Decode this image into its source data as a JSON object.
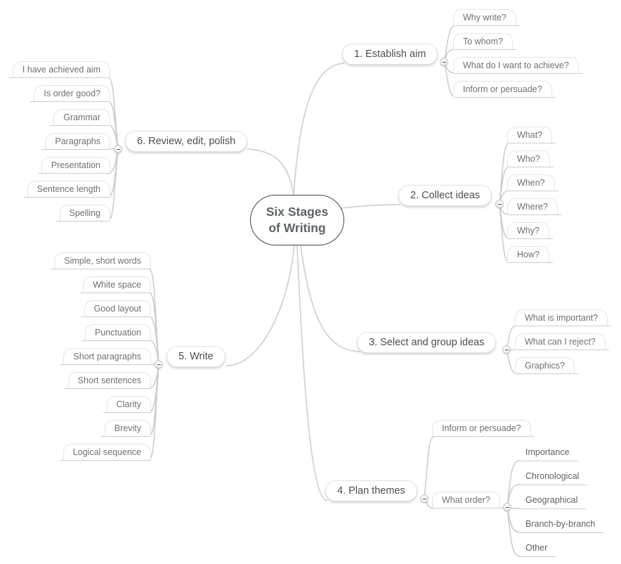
{
  "central_topic": {
    "line1": "Six Stages",
    "line2": "of Writing"
  },
  "branches": [
    {
      "label": "1. Establish aim",
      "children": [
        "Why write?",
        "To whom?",
        "What do I want to achieve?",
        "Inform or persuade?"
      ]
    },
    {
      "label": "2. Collect ideas",
      "children": [
        "What?",
        "Who?",
        "When?",
        "Where?",
        "Why?",
        "How?"
      ]
    },
    {
      "label": "3. Select and group ideas",
      "children": [
        "What is important?",
        "What can I reject?",
        "Graphics?"
      ]
    },
    {
      "label": "4. Plan themes",
      "children": [
        {
          "label": "Inform or persuade?"
        },
        {
          "label": "What order?",
          "children": [
            "Importance",
            "Chronological",
            "Geographical",
            "Branch-by-branch",
            "Other"
          ]
        }
      ]
    },
    {
      "label": "5. Write",
      "children": [
        "Simple, short words",
        "White space",
        "Good layout",
        "Punctuation",
        "Short paragraphs",
        "Short sentences",
        "Clarity",
        "Brevity",
        "Logical sequence"
      ]
    },
    {
      "label": "6. Review, edit, polish",
      "children": [
        "I have achieved aim",
        "Is order good?",
        "Grammar",
        "Paragraphs",
        "Presentation",
        "Sentence length",
        "Spelling"
      ]
    }
  ],
  "colors": {
    "central_border": "#3d4648",
    "connector": "#c9cdd1",
    "text": "#4a4e51"
  }
}
